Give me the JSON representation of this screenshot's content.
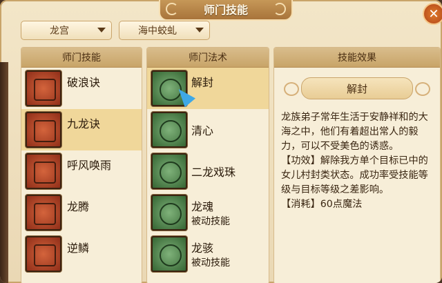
{
  "window": {
    "title": "师门技能",
    "close_icon": "close-icon"
  },
  "filters": {
    "school": "龙宫",
    "subtype": "海中蛟虬"
  },
  "columns": {
    "skills": "师门技能",
    "spells": "师门法术",
    "effect": "技能效果"
  },
  "skills": [
    {
      "name": "破浪诀",
      "icon": "skill-icon"
    },
    {
      "name": "九龙诀",
      "icon": "skill-icon",
      "selected": true
    },
    {
      "name": "呼风唤雨",
      "icon": "skill-icon"
    },
    {
      "name": "龙腾",
      "icon": "skill-icon"
    },
    {
      "name": "逆鳞",
      "icon": "skill-icon"
    }
  ],
  "spells": [
    {
      "name": "解封",
      "sub": "",
      "icon": "spell-icon",
      "selected": true
    },
    {
      "name": "清心",
      "sub": "",
      "icon": "spell-icon"
    },
    {
      "name": "二龙戏珠",
      "sub": "",
      "icon": "spell-icon"
    },
    {
      "name": "龙魂",
      "sub": "被动技能",
      "icon": "spell-icon"
    },
    {
      "name": "龙骇",
      "sub": "被动技能",
      "icon": "spell-icon"
    }
  ],
  "effect": {
    "title": "解封",
    "description": "龙族弟子常年生活于安静祥和的大海之中，他们有着超出常人的毅力，可以不受美色的诱惑。",
    "efficacy": "【功效】解除我方单个目标已中的女儿村封类状态。成功率受技能等级与目标等级之差影响。",
    "cost": "【消耗】60点魔法"
  }
}
